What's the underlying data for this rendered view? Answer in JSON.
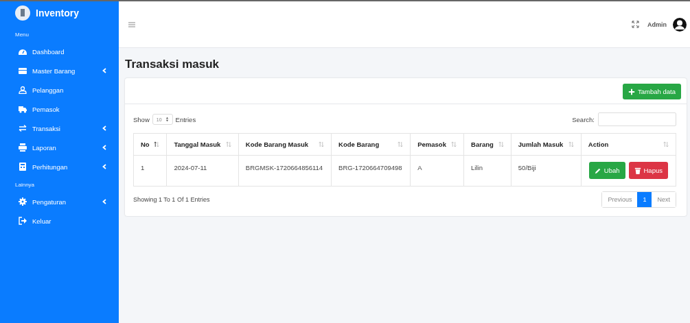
{
  "sidebar": {
    "brand": "Inventory",
    "sections": [
      {
        "heading": "Menu",
        "items": [
          {
            "label": "Dashboard",
            "expandable": false
          },
          {
            "label": "Master Barang",
            "expandable": true
          },
          {
            "label": "Pelanggan",
            "expandable": false
          },
          {
            "label": "Pemasok",
            "expandable": false
          },
          {
            "label": "Transaksi",
            "expandable": true
          },
          {
            "label": "Laporan",
            "expandable": true
          },
          {
            "label": "Perhitungan",
            "expandable": true
          }
        ]
      },
      {
        "heading": "Lainnya",
        "items": [
          {
            "label": "Pengaturan",
            "expandable": true
          },
          {
            "label": "Keluar",
            "expandable": false
          }
        ]
      }
    ]
  },
  "header": {
    "user": "Admin"
  },
  "page_title": "Transaksi masuk",
  "add_button": "Tambah data",
  "length": {
    "before": "Show",
    "value": "10",
    "after": "Entries"
  },
  "search": {
    "label": "Search:"
  },
  "table": {
    "columns": [
      {
        "label": "No",
        "sorted": true
      },
      {
        "label": "Tanggal Masuk",
        "sorted": false
      },
      {
        "label": "Kode Barang Masuk",
        "sorted": false
      },
      {
        "label": "Kode Barang",
        "sorted": false
      },
      {
        "label": "Pemasok",
        "sorted": false
      },
      {
        "label": "Barang",
        "sorted": false
      },
      {
        "label": "Jumlah Masuk",
        "sorted": false
      },
      {
        "label": "Action",
        "sorted": false
      }
    ],
    "rows": [
      {
        "cells": [
          "1",
          "2024-07-11",
          "BRGMSK-1720664856114",
          "BRG-1720664709498",
          "A",
          "Lilin",
          "50/Biji"
        ],
        "actions": [
          {
            "label": "Ubah",
            "kind": "edit"
          },
          {
            "label": "Hapus",
            "kind": "delete"
          }
        ]
      }
    ]
  },
  "info": "Showing 1 To 1 Of 1 Entries",
  "pagination": [
    {
      "label": "Previous",
      "selected": false,
      "disabled": true
    },
    {
      "label": "1",
      "selected": true,
      "disabled": false
    },
    {
      "label": "Next",
      "selected": false,
      "disabled": true
    }
  ]
}
